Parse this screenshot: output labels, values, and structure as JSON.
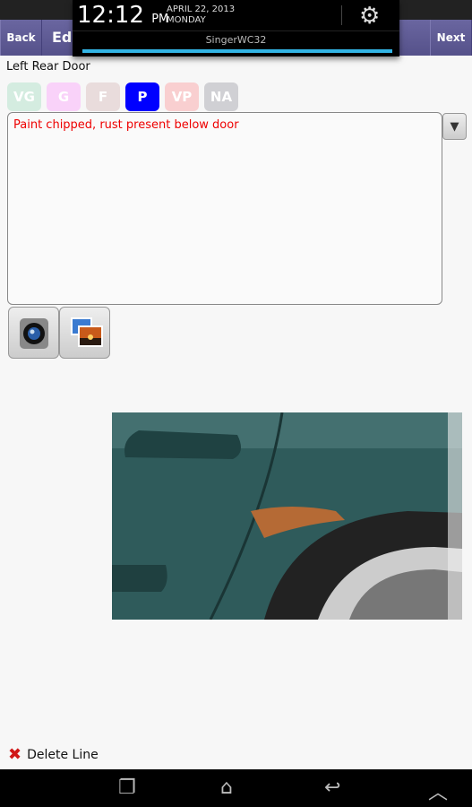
{
  "notification": {
    "time": "12:12",
    "ampm": "PM",
    "date": "APRIL 22, 2013",
    "weekday": "MONDAY",
    "network": "SingerWC32",
    "progress": 1.0
  },
  "actionbar": {
    "back": "Back",
    "title": "Edi",
    "next": "Next"
  },
  "item": {
    "label": "Left Rear Door"
  },
  "ratings": [
    {
      "label": "VG",
      "color": "#d4ece0",
      "selected": false
    },
    {
      "label": "G",
      "color": "#f9d2f9",
      "selected": false
    },
    {
      "label": "F",
      "color": "#e9dcdc",
      "selected": false
    },
    {
      "label": "P",
      "color": "#0000ff",
      "selected": true
    },
    {
      "label": "VP",
      "color": "#f9cfd0",
      "selected": false
    },
    {
      "label": "NA",
      "color": "#d0d0d4",
      "selected": false
    }
  ],
  "notes": {
    "value": "Paint chipped, rust present below door"
  },
  "actions": {
    "delete": "Delete Line"
  }
}
